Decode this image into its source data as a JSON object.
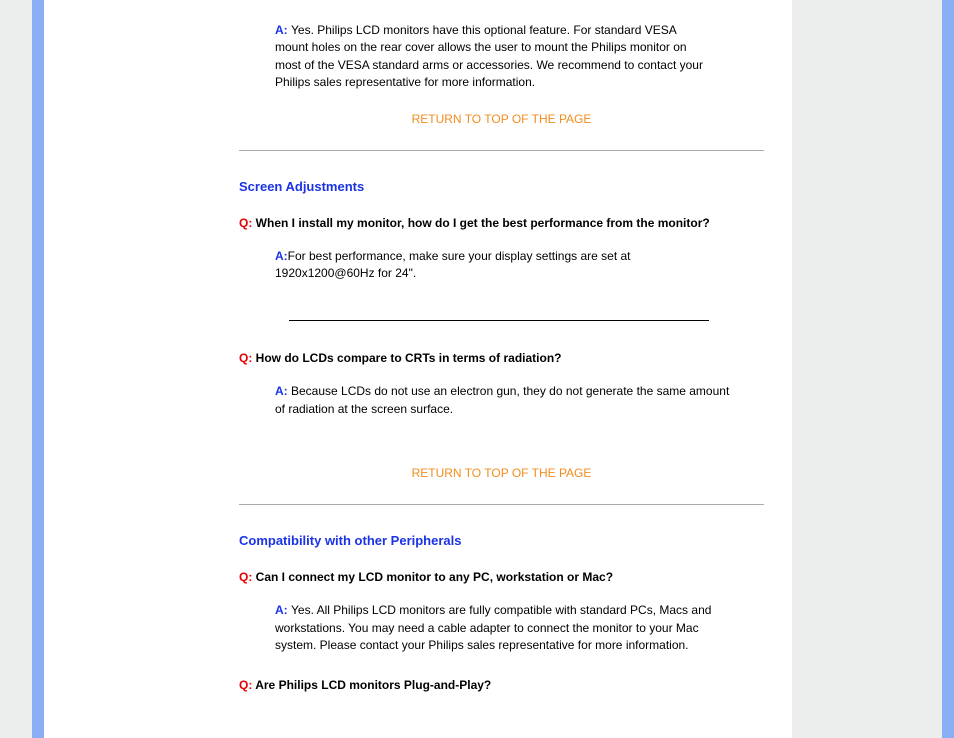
{
  "faq0": {
    "aPrefix": "A: ",
    "answer": "Yes. Philips LCD monitors have this optional feature. For standard VESA mount holes on the rear cover allows the user to mount the Philips monitor on most of the VESA standard arms or accessories. We recommend to contact your Philips sales representative for more information."
  },
  "returnLink1": "RETURN TO TOP OF THE PAGE",
  "section1": {
    "heading": "Screen Adjustments",
    "q1Prefix": "Q: ",
    "q1": "When I install my monitor, how do I get the best performance from the monitor?",
    "a1Prefix": "A:",
    "a1": "For best performance, make sure your display settings are set at 1920x1200@60Hz for 24\".",
    "q2Prefix": "Q: ",
    "q2": "How do LCDs compare to CRTs in terms of radiation?",
    "a2Prefix": "A: ",
    "a2": "Because LCDs do not use an electron gun, they do not generate the same amount of radiation at the screen surface."
  },
  "returnLink2": "RETURN TO TOP OF THE PAGE",
  "section2": {
    "heading": "Compatibility with other Peripherals",
    "q1Prefix": "Q: ",
    "q1": "Can I connect my LCD monitor to any PC, workstation or Mac?",
    "a1Prefix": "A: ",
    "a1": "Yes. All Philips LCD monitors are fully compatible with standard PCs, Macs and workstations. You may need a cable adapter to connect the monitor to your Mac system. Please contact your Philips sales representative for more information.",
    "q2Prefix": "Q: ",
    "q2": "Are Philips LCD monitors Plug-and-Play?"
  }
}
